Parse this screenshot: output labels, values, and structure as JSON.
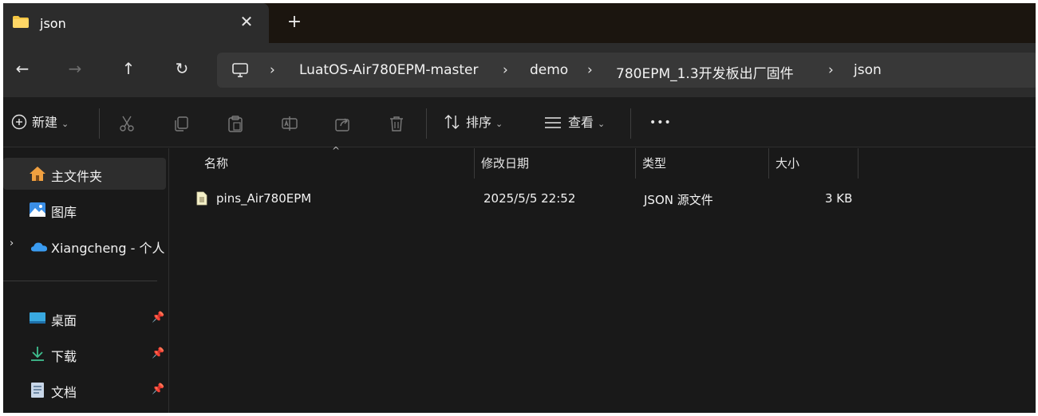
{
  "window": {
    "tab_title": "json",
    "close_glyph": "✕",
    "new_tab_glyph": "+"
  },
  "nav": {
    "back": "←",
    "forward": "→",
    "up": "↑",
    "refresh": "↻",
    "breadcrumbs": [
      "LuatOS-Air780EPM-master",
      "demo",
      "780EPM_1.3开发板出厂固件",
      "json"
    ],
    "separator": "›"
  },
  "toolbar": {
    "new_label": "新建",
    "sort_label": "排序",
    "view_label": "查看",
    "more_label": "•••",
    "dropdown": "⌄"
  },
  "sidebar": {
    "items": [
      {
        "label": "主文件夹",
        "icon": "home-icon"
      },
      {
        "label": "图库",
        "icon": "gallery-icon"
      },
      {
        "label": "Xiangcheng - 个人",
        "icon": "onedrive-cloud-icon"
      },
      {
        "label": "桌面",
        "icon": "desktop-icon"
      },
      {
        "label": "下载",
        "icon": "download-icon"
      },
      {
        "label": "文档",
        "icon": "documents-icon"
      }
    ],
    "pin_glyph": "📌",
    "expander": "›"
  },
  "columns": {
    "name": "名称",
    "modified": "修改日期",
    "type": "类型",
    "size": "大小"
  },
  "files": [
    {
      "name": "pins_Air780EPM",
      "modified": "2025/5/5 22:52",
      "type": "JSON 源文件",
      "size": "3 KB"
    }
  ],
  "colors": {
    "window_bg": "#191919",
    "tab_bg": "#2c2c2c",
    "titlebar_bg": "#1b150f",
    "folder_yellow": "#f4c542",
    "accent_blue": "#4aa3ff"
  }
}
